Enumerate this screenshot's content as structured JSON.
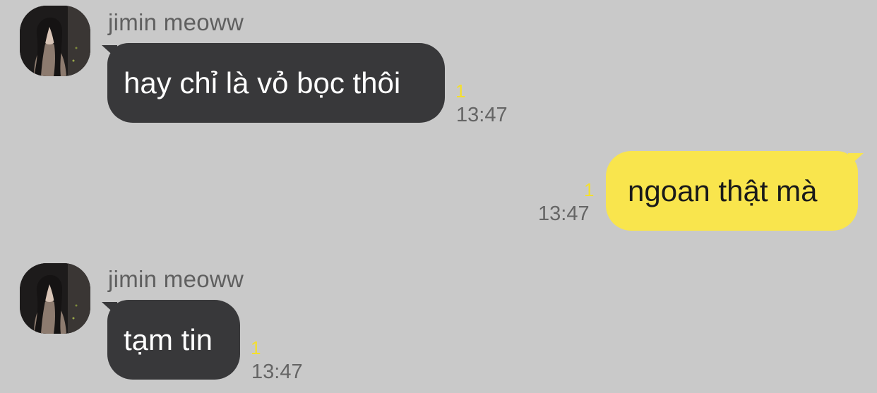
{
  "colors": {
    "background": "#c9c9c9",
    "incoming_bubble": "#38383a",
    "outgoing_bubble": "#f9e54d",
    "unread_count": "#f4df2c",
    "timestamp": "#656565",
    "sender_name": "#5f5f5f"
  },
  "messages": [
    {
      "direction": "incoming",
      "sender": "jimin meoww",
      "avatar_icon": "profile-photo",
      "text": "hay chỉ là vỏ bọc thôi",
      "unread": "1",
      "time": "13:47"
    },
    {
      "direction": "outgoing",
      "text": "ngoan thật mà",
      "unread": "1",
      "time": "13:47"
    },
    {
      "direction": "incoming",
      "sender": "jimin meoww",
      "avatar_icon": "profile-photo",
      "text": "tạm tin",
      "unread": "1",
      "time": "13:47"
    }
  ]
}
